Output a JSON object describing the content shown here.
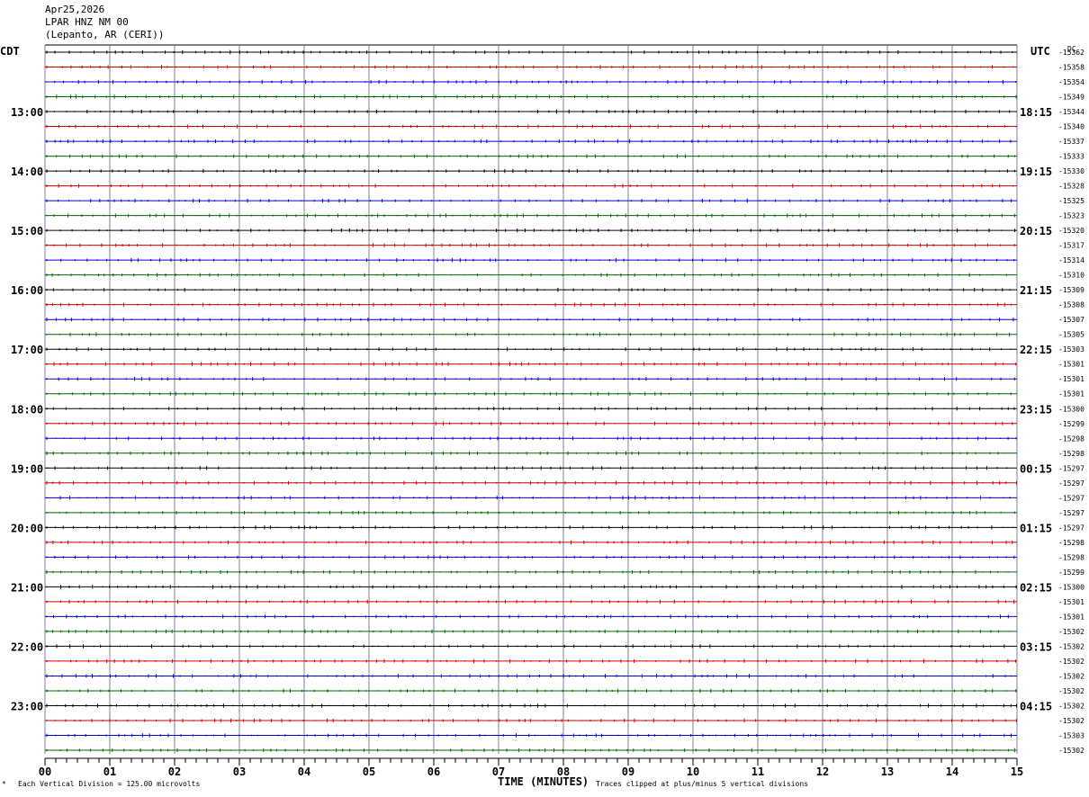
{
  "header": {
    "date": "Apr25,2026",
    "station": "LPAR HNZ NM 00",
    "location": "(Lepanto, AR (CERI))"
  },
  "chart_data": {
    "type": "line",
    "left_tz": "CDT",
    "right_tz": "UTC",
    "dc_label": "DC",
    "trace_colors": [
      "#000000",
      "#cc0000",
      "#0000cc",
      "#006600"
    ],
    "grid_color": "#7f7f9f",
    "rows": 48,
    "x_ticks": [
      "00",
      "01",
      "02",
      "03",
      "04",
      "05",
      "06",
      "07",
      "08",
      "09",
      "10",
      "11",
      "12",
      "13",
      "14",
      "15"
    ],
    "xlabel": "TIME (MINUTES)",
    "xlim": [
      0,
      15
    ],
    "left_hour_labels": [
      "13:00",
      "14:00",
      "15:00",
      "16:00",
      "17:00",
      "18:00",
      "19:00",
      "20:00",
      "21:00",
      "22:00",
      "23:00"
    ],
    "right_hour_labels": [
      "18:15",
      "19:15",
      "20:15",
      "21:15",
      "22:15",
      "23:15",
      "00:15",
      "01:15",
      "02:15",
      "03:15",
      "04:15"
    ],
    "dc_offsets": [
      "-15362",
      "-15358",
      "-15354",
      "-15349",
      "-15344",
      "-15340",
      "-15337",
      "-15333",
      "-15330",
      "-15328",
      "-15325",
      "-15323",
      "-15320",
      "-15317",
      "-15314",
      "-15310",
      "-15309",
      "-15308",
      "-15307",
      "-15305",
      "-15303",
      "-15301",
      "-15301",
      "-15301",
      "-15300",
      "-15299",
      "-15298",
      "-15298",
      "-15297",
      "-15297",
      "-15297",
      "-15297",
      "-15297",
      "-15298",
      "-15298",
      "-15299",
      "-15300",
      "-15301",
      "-15301",
      "-15302",
      "-15302",
      "-15302",
      "-15302",
      "-15302",
      "-15302",
      "-15302",
      "-15303",
      "-15302"
    ]
  },
  "footer": {
    "scale_note": "Each Vertical Division =  125.00 microvolts",
    "clip_note": "Traces clipped at plus/minus 5 vertical divisions"
  }
}
